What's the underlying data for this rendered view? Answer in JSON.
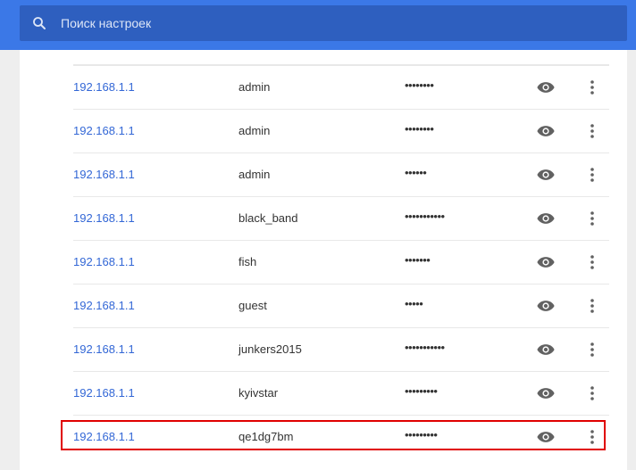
{
  "search": {
    "placeholder": "Поиск настроек"
  },
  "colors": {
    "accent": "#3b78e7",
    "link": "#3367d6",
    "highlight": "#e00000"
  },
  "passwords": {
    "rows": [
      {
        "site": "192.168.1.1",
        "username": "admin",
        "password_mask": "••••••••"
      },
      {
        "site": "192.168.1.1",
        "username": "admin",
        "password_mask": "••••••••"
      },
      {
        "site": "192.168.1.1",
        "username": "admin",
        "password_mask": "••••••"
      },
      {
        "site": "192.168.1.1",
        "username": "black_band",
        "password_mask": "•••••••••••"
      },
      {
        "site": "192.168.1.1",
        "username": "fish",
        "password_mask": "•••••••"
      },
      {
        "site": "192.168.1.1",
        "username": "guest",
        "password_mask": "•••••"
      },
      {
        "site": "192.168.1.1",
        "username": "junkers2015",
        "password_mask": "•••••••••••"
      },
      {
        "site": "192.168.1.1",
        "username": "kyivstar",
        "password_mask": "•••••••••"
      },
      {
        "site": "192.168.1.1",
        "username": "qe1dg7bm",
        "password_mask": "•••••••••"
      }
    ]
  },
  "icons": {
    "search": "search-icon",
    "show_password": "eye-icon",
    "more_actions": "more-vert-icon"
  }
}
